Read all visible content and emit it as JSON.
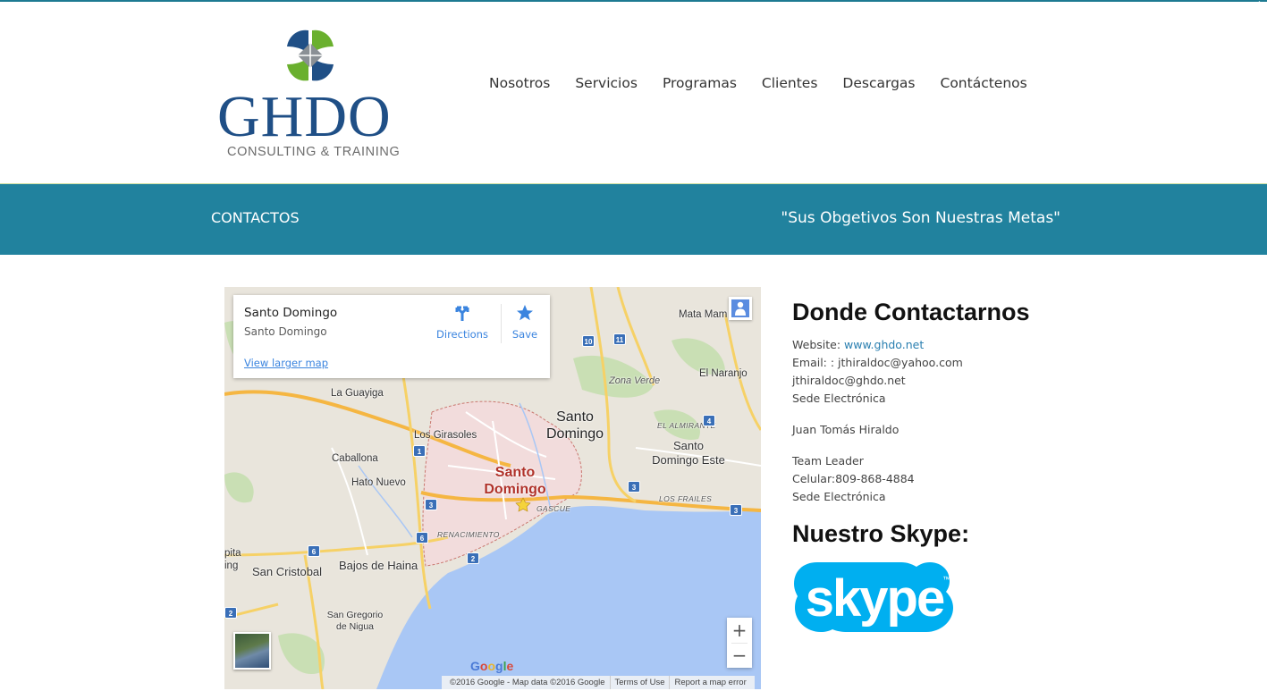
{
  "header": {
    "logo": {
      "wordmark": "GHDO",
      "tagline": "CONSULTING & TRAINING",
      "colors": {
        "blue": "#1f4f86",
        "green": "#6ab02e",
        "gray": "#8a9095"
      }
    },
    "nav": [
      {
        "label": "Nosotros"
      },
      {
        "label": "Servicios"
      },
      {
        "label": "Programas"
      },
      {
        "label": "Clientes"
      },
      {
        "label": "Descargas"
      },
      {
        "label": "Contáctenos"
      }
    ]
  },
  "banner": {
    "title": "CONTACTOS",
    "slogan": "\"Sus Obgetivos Son Nuestras Metas\"",
    "color": "#21829e"
  },
  "map": {
    "card": {
      "title": "Santo Domingo",
      "subtitle": "Santo Domingo",
      "directions_label": "Directions",
      "save_label": "Save",
      "larger_map_link": "View larger map"
    },
    "labels": {
      "mata_mamon": "Mata Mam",
      "el_naranjo": "El Naranjo",
      "zona_verde": "Zona Verde",
      "la_guayiga": "La Guayiga",
      "santo_domingo_north_1": "Santo",
      "santo_domingo_north_2": "Domingo",
      "el_almirante": "EL ALMIRANTE",
      "los_girasoles": "Los Girasoles",
      "sd_este_1": "Santo",
      "sd_este_2": "Domingo Este",
      "caballona": "Caballona",
      "sd_city_1": "Santo",
      "sd_city_2": "Domingo",
      "hato_nuevo": "Hato Nuevo",
      "los_frailes": "LOS FRAILES",
      "gascue": "GASCUE",
      "renacimiento": "RENACIMIENTO",
      "pita_1": "pita",
      "pita_2": "ing",
      "san_cristobal": "San Cristobal",
      "bajos_de_haina": "Bajos de Haina",
      "san_gregorio_1": "San Gregorio",
      "san_gregorio_2": "de Nigua"
    },
    "shields": [
      "10",
      "11",
      "4",
      "1",
      "3",
      "3",
      "3",
      "6",
      "6",
      "2",
      "2"
    ],
    "zoom_in": "+",
    "zoom_out": "−",
    "google_logo": [
      "G",
      "o",
      "o",
      "g",
      "l",
      "e"
    ],
    "footer": [
      "©2016 Google - Map data ©2016 Google",
      "Terms of Use",
      "Report a map error"
    ]
  },
  "contact": {
    "heading": "Donde Contactarnos",
    "website_label": "Website: ",
    "website_link": "www.ghdo.net",
    "email_line": "Email: : jthiraldoc@yahoo.com",
    "email_line2": "jthiraldoc@ghdo.net",
    "sede_1": "Sede Electrónica",
    "name": "Juan Tomás Hiraldo",
    "role": "Team Leader",
    "phone": "Celular:809-868-4884",
    "sede_2": "Sede Electrónica",
    "skype_heading": "Nuestro Skype:",
    "skype_logo_text": "skype",
    "skype_color": "#00aff0"
  }
}
